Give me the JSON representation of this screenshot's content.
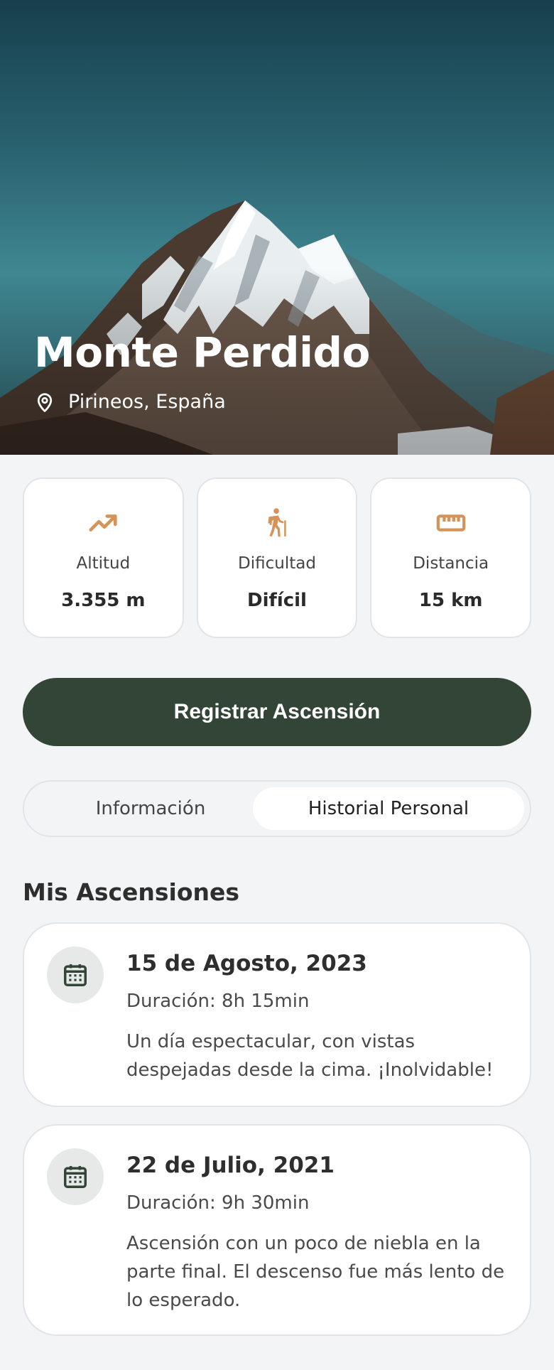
{
  "hero": {
    "title": "Monte Perdido",
    "location": "Pirineos, España",
    "location_icon": "map-pin-icon"
  },
  "stats": [
    {
      "icon": "trending-up-icon",
      "label": "Altitud",
      "value": "3.355 m"
    },
    {
      "icon": "hiking-icon",
      "label": "Dificultad",
      "value": "Difícil"
    },
    {
      "icon": "ruler-icon",
      "label": "Distancia",
      "value": "15 km"
    }
  ],
  "accent_color": "#d4935a",
  "primary_button": {
    "label": "Registrar Ascensión",
    "color": "#334537"
  },
  "tabs": [
    {
      "label": "Información",
      "active": false
    },
    {
      "label": "Historial Personal",
      "active": true
    }
  ],
  "section_title": "Mis Ascensiones",
  "ascents": [
    {
      "date": "15 de Agosto, 2023",
      "duration": "Duración: 8h 15min",
      "note": "Un día espectacular, con vistas despejadas desde la cima. ¡Inolvidable!"
    },
    {
      "date": "22 de Julio, 2021",
      "duration": "Duración: 9h 30min",
      "note": "Ascensión con un poco de niebla en la parte final. El descenso fue más lento de lo esperado."
    }
  ]
}
